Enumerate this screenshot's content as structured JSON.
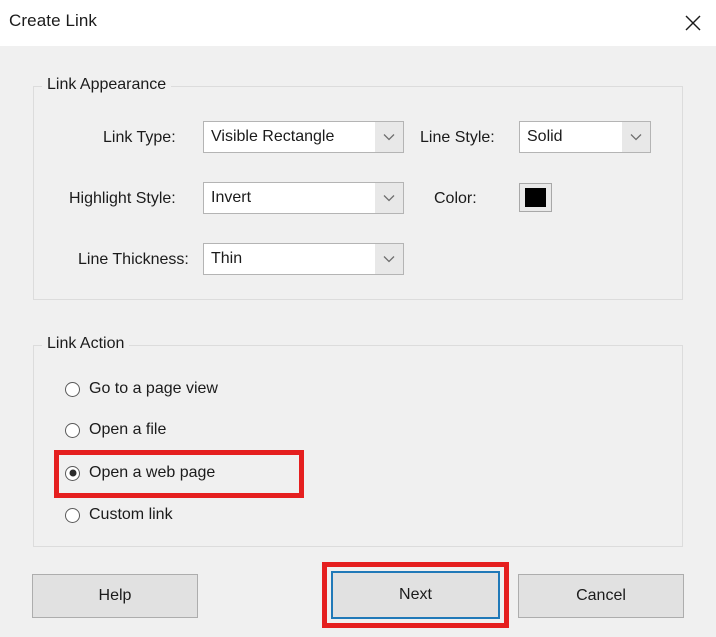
{
  "dialog": {
    "title": "Create Link",
    "close_icon": "close-icon"
  },
  "appearance": {
    "group_label": "Link Appearance",
    "fields": [
      {
        "label": "Link Type:",
        "value": "Visible Rectangle"
      },
      {
        "label": "Highlight Style:",
        "value": "Invert"
      },
      {
        "label": "Line Thickness:",
        "value": "Thin"
      },
      {
        "label": "Line Style:",
        "value": "Solid"
      }
    ],
    "color": {
      "label": "Color:",
      "value": "#000000"
    }
  },
  "action": {
    "group_label": "Link Action",
    "options": [
      {
        "label": "Go to a page view",
        "selected": false
      },
      {
        "label": "Open a file",
        "selected": false
      },
      {
        "label": "Open a web page",
        "selected": true
      },
      {
        "label": "Custom link",
        "selected": false
      }
    ]
  },
  "buttons": {
    "help": "Help",
    "next": "Next",
    "cancel": "Cancel"
  },
  "annotations": {
    "color": "#e51f1f",
    "focus_color": "#2079b8",
    "highlighted": [
      "Open a web page",
      "Next"
    ]
  }
}
